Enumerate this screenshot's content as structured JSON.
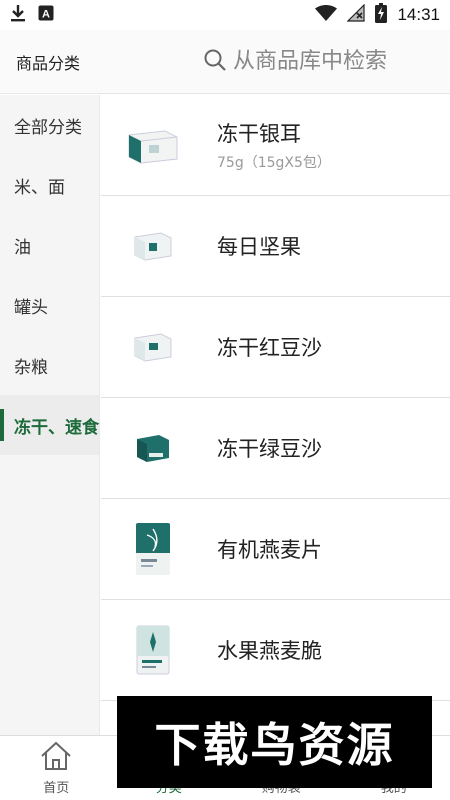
{
  "status": {
    "time": "14:31"
  },
  "header": {
    "title": "商品分类",
    "search_placeholder": "从商品库中检索"
  },
  "sidebar": {
    "items": [
      {
        "label": "全部分类"
      },
      {
        "label": "米、面"
      },
      {
        "label": "油"
      },
      {
        "label": "罐头"
      },
      {
        "label": "杂粮"
      },
      {
        "label": "冻干、速食"
      }
    ],
    "active_index": 5
  },
  "products": [
    {
      "name": "冻干银耳",
      "spec": "75g（15gX5包）"
    },
    {
      "name": "每日坚果",
      "spec": ""
    },
    {
      "name": "冻干红豆沙",
      "spec": ""
    },
    {
      "name": "冻干绿豆沙",
      "spec": ""
    },
    {
      "name": "有机燕麦片",
      "spec": ""
    },
    {
      "name": "水果燕麦脆",
      "spec": ""
    }
  ],
  "tabbar": [
    {
      "label": "首页",
      "icon": "home-icon"
    },
    {
      "label": "分类",
      "icon": "category-icon"
    },
    {
      "label": "购物袋",
      "icon": "bag-icon"
    },
    {
      "label": "我的",
      "icon": "user-icon"
    }
  ],
  "watermark": {
    "text": "下载鸟资源"
  },
  "colors": {
    "accent": "#1d6b3a",
    "product_teal": "#1f6f6a"
  }
}
